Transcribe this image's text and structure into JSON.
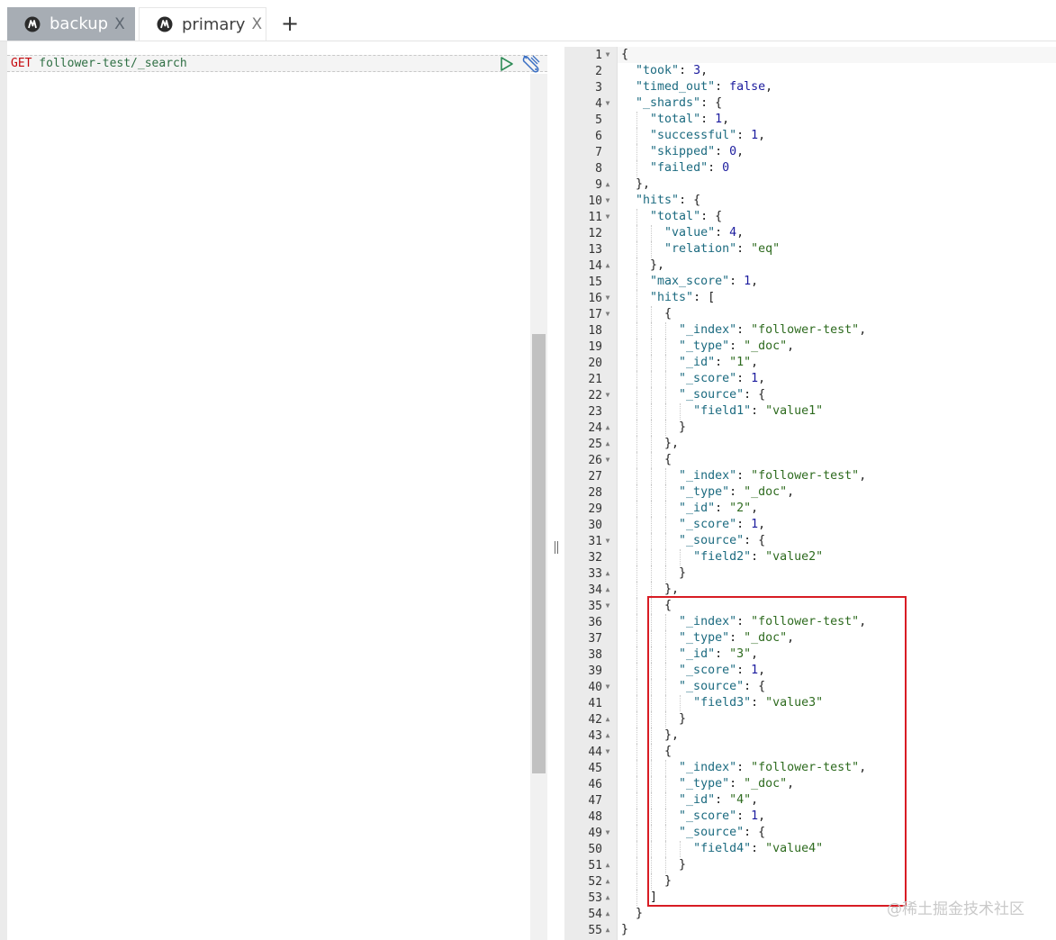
{
  "tabs": [
    {
      "label": "backup",
      "close": "X",
      "active": true,
      "icon": "elastic-logo-icon"
    },
    {
      "label": "primary",
      "close": "X",
      "active": false,
      "icon": "elastic-logo-icon"
    }
  ],
  "add_tab": "+",
  "request": {
    "method": "GET",
    "path": " follower-test/_search"
  },
  "response": {
    "lines": [
      {
        "n": "1",
        "fold": "down",
        "indent": 0,
        "tokens": [
          [
            "p",
            "{"
          ]
        ]
      },
      {
        "n": "2",
        "fold": "",
        "indent": 1,
        "tokens": [
          [
            "k",
            "\"took\""
          ],
          [
            "p",
            ": "
          ],
          [
            "n",
            "3"
          ],
          [
            "p",
            ","
          ]
        ]
      },
      {
        "n": "3",
        "fold": "",
        "indent": 1,
        "tokens": [
          [
            "k",
            "\"timed_out\""
          ],
          [
            "p",
            ": "
          ],
          [
            "b",
            "false"
          ],
          [
            "p",
            ","
          ]
        ]
      },
      {
        "n": "4",
        "fold": "down",
        "indent": 1,
        "tokens": [
          [
            "k",
            "\"_shards\""
          ],
          [
            "p",
            ": {"
          ]
        ]
      },
      {
        "n": "5",
        "fold": "",
        "indent": 2,
        "tokens": [
          [
            "k",
            "\"total\""
          ],
          [
            "p",
            ": "
          ],
          [
            "n",
            "1"
          ],
          [
            "p",
            ","
          ]
        ]
      },
      {
        "n": "6",
        "fold": "",
        "indent": 2,
        "tokens": [
          [
            "k",
            "\"successful\""
          ],
          [
            "p",
            ": "
          ],
          [
            "n",
            "1"
          ],
          [
            "p",
            ","
          ]
        ]
      },
      {
        "n": "7",
        "fold": "",
        "indent": 2,
        "tokens": [
          [
            "k",
            "\"skipped\""
          ],
          [
            "p",
            ": "
          ],
          [
            "n",
            "0"
          ],
          [
            "p",
            ","
          ]
        ]
      },
      {
        "n": "8",
        "fold": "",
        "indent": 2,
        "tokens": [
          [
            "k",
            "\"failed\""
          ],
          [
            "p",
            ": "
          ],
          [
            "n",
            "0"
          ]
        ]
      },
      {
        "n": "9",
        "fold": "up",
        "indent": 1,
        "tokens": [
          [
            "p",
            "},"
          ]
        ]
      },
      {
        "n": "10",
        "fold": "down",
        "indent": 1,
        "tokens": [
          [
            "k",
            "\"hits\""
          ],
          [
            "p",
            ": {"
          ]
        ]
      },
      {
        "n": "11",
        "fold": "down",
        "indent": 2,
        "tokens": [
          [
            "k",
            "\"total\""
          ],
          [
            "p",
            ": {"
          ]
        ]
      },
      {
        "n": "12",
        "fold": "",
        "indent": 3,
        "tokens": [
          [
            "k",
            "\"value\""
          ],
          [
            "p",
            ": "
          ],
          [
            "n",
            "4"
          ],
          [
            "p",
            ","
          ]
        ]
      },
      {
        "n": "13",
        "fold": "",
        "indent": 3,
        "tokens": [
          [
            "k",
            "\"relation\""
          ],
          [
            "p",
            ": "
          ],
          [
            "s",
            "\"eq\""
          ]
        ]
      },
      {
        "n": "14",
        "fold": "up",
        "indent": 2,
        "tokens": [
          [
            "p",
            "},"
          ]
        ]
      },
      {
        "n": "15",
        "fold": "",
        "indent": 2,
        "tokens": [
          [
            "k",
            "\"max_score\""
          ],
          [
            "p",
            ": "
          ],
          [
            "n",
            "1"
          ],
          [
            "p",
            ","
          ]
        ]
      },
      {
        "n": "16",
        "fold": "down",
        "indent": 2,
        "tokens": [
          [
            "k",
            "\"hits\""
          ],
          [
            "p",
            ": ["
          ]
        ]
      },
      {
        "n": "17",
        "fold": "down",
        "indent": 3,
        "tokens": [
          [
            "p",
            "{"
          ]
        ]
      },
      {
        "n": "18",
        "fold": "",
        "indent": 4,
        "tokens": [
          [
            "k",
            "\"_index\""
          ],
          [
            "p",
            ": "
          ],
          [
            "s",
            "\"follower-test\""
          ],
          [
            "p",
            ","
          ]
        ]
      },
      {
        "n": "19",
        "fold": "",
        "indent": 4,
        "tokens": [
          [
            "k",
            "\"_type\""
          ],
          [
            "p",
            ": "
          ],
          [
            "s",
            "\"_doc\""
          ],
          [
            "p",
            ","
          ]
        ]
      },
      {
        "n": "20",
        "fold": "",
        "indent": 4,
        "tokens": [
          [
            "k",
            "\"_id\""
          ],
          [
            "p",
            ": "
          ],
          [
            "s",
            "\"1\""
          ],
          [
            "p",
            ","
          ]
        ]
      },
      {
        "n": "21",
        "fold": "",
        "indent": 4,
        "tokens": [
          [
            "k",
            "\"_score\""
          ],
          [
            "p",
            ": "
          ],
          [
            "n",
            "1"
          ],
          [
            "p",
            ","
          ]
        ]
      },
      {
        "n": "22",
        "fold": "down",
        "indent": 4,
        "tokens": [
          [
            "k",
            "\"_source\""
          ],
          [
            "p",
            ": {"
          ]
        ]
      },
      {
        "n": "23",
        "fold": "",
        "indent": 5,
        "tokens": [
          [
            "k",
            "\"field1\""
          ],
          [
            "p",
            ": "
          ],
          [
            "s",
            "\"value1\""
          ]
        ]
      },
      {
        "n": "24",
        "fold": "up",
        "indent": 4,
        "tokens": [
          [
            "p",
            "}"
          ]
        ]
      },
      {
        "n": "25",
        "fold": "up",
        "indent": 3,
        "tokens": [
          [
            "p",
            "},"
          ]
        ]
      },
      {
        "n": "26",
        "fold": "down",
        "indent": 3,
        "tokens": [
          [
            "p",
            "{"
          ]
        ]
      },
      {
        "n": "27",
        "fold": "",
        "indent": 4,
        "tokens": [
          [
            "k",
            "\"_index\""
          ],
          [
            "p",
            ": "
          ],
          [
            "s",
            "\"follower-test\""
          ],
          [
            "p",
            ","
          ]
        ]
      },
      {
        "n": "28",
        "fold": "",
        "indent": 4,
        "tokens": [
          [
            "k",
            "\"_type\""
          ],
          [
            "p",
            ": "
          ],
          [
            "s",
            "\"_doc\""
          ],
          [
            "p",
            ","
          ]
        ]
      },
      {
        "n": "29",
        "fold": "",
        "indent": 4,
        "tokens": [
          [
            "k",
            "\"_id\""
          ],
          [
            "p",
            ": "
          ],
          [
            "s",
            "\"2\""
          ],
          [
            "p",
            ","
          ]
        ]
      },
      {
        "n": "30",
        "fold": "",
        "indent": 4,
        "tokens": [
          [
            "k",
            "\"_score\""
          ],
          [
            "p",
            ": "
          ],
          [
            "n",
            "1"
          ],
          [
            "p",
            ","
          ]
        ]
      },
      {
        "n": "31",
        "fold": "down",
        "indent": 4,
        "tokens": [
          [
            "k",
            "\"_source\""
          ],
          [
            "p",
            ": {"
          ]
        ]
      },
      {
        "n": "32",
        "fold": "",
        "indent": 5,
        "tokens": [
          [
            "k",
            "\"field2\""
          ],
          [
            "p",
            ": "
          ],
          [
            "s",
            "\"value2\""
          ]
        ]
      },
      {
        "n": "33",
        "fold": "up",
        "indent": 4,
        "tokens": [
          [
            "p",
            "}"
          ]
        ]
      },
      {
        "n": "34",
        "fold": "up",
        "indent": 3,
        "tokens": [
          [
            "p",
            "},"
          ]
        ]
      },
      {
        "n": "35",
        "fold": "down",
        "indent": 3,
        "tokens": [
          [
            "p",
            "{"
          ]
        ]
      },
      {
        "n": "36",
        "fold": "",
        "indent": 4,
        "tokens": [
          [
            "k",
            "\"_index\""
          ],
          [
            "p",
            ": "
          ],
          [
            "s",
            "\"follower-test\""
          ],
          [
            "p",
            ","
          ]
        ]
      },
      {
        "n": "37",
        "fold": "",
        "indent": 4,
        "tokens": [
          [
            "k",
            "\"_type\""
          ],
          [
            "p",
            ": "
          ],
          [
            "s",
            "\"_doc\""
          ],
          [
            "p",
            ","
          ]
        ]
      },
      {
        "n": "38",
        "fold": "",
        "indent": 4,
        "tokens": [
          [
            "k",
            "\"_id\""
          ],
          [
            "p",
            ": "
          ],
          [
            "s",
            "\"3\""
          ],
          [
            "p",
            ","
          ]
        ]
      },
      {
        "n": "39",
        "fold": "",
        "indent": 4,
        "tokens": [
          [
            "k",
            "\"_score\""
          ],
          [
            "p",
            ": "
          ],
          [
            "n",
            "1"
          ],
          [
            "p",
            ","
          ]
        ]
      },
      {
        "n": "40",
        "fold": "down",
        "indent": 4,
        "tokens": [
          [
            "k",
            "\"_source\""
          ],
          [
            "p",
            ": {"
          ]
        ]
      },
      {
        "n": "41",
        "fold": "",
        "indent": 5,
        "tokens": [
          [
            "k",
            "\"field3\""
          ],
          [
            "p",
            ": "
          ],
          [
            "s",
            "\"value3\""
          ]
        ]
      },
      {
        "n": "42",
        "fold": "up",
        "indent": 4,
        "tokens": [
          [
            "p",
            "}"
          ]
        ]
      },
      {
        "n": "43",
        "fold": "up",
        "indent": 3,
        "tokens": [
          [
            "p",
            "},"
          ]
        ]
      },
      {
        "n": "44",
        "fold": "down",
        "indent": 3,
        "tokens": [
          [
            "p",
            "{"
          ]
        ]
      },
      {
        "n": "45",
        "fold": "",
        "indent": 4,
        "tokens": [
          [
            "k",
            "\"_index\""
          ],
          [
            "p",
            ": "
          ],
          [
            "s",
            "\"follower-test\""
          ],
          [
            "p",
            ","
          ]
        ]
      },
      {
        "n": "46",
        "fold": "",
        "indent": 4,
        "tokens": [
          [
            "k",
            "\"_type\""
          ],
          [
            "p",
            ": "
          ],
          [
            "s",
            "\"_doc\""
          ],
          [
            "p",
            ","
          ]
        ]
      },
      {
        "n": "47",
        "fold": "",
        "indent": 4,
        "tokens": [
          [
            "k",
            "\"_id\""
          ],
          [
            "p",
            ": "
          ],
          [
            "s",
            "\"4\""
          ],
          [
            "p",
            ","
          ]
        ]
      },
      {
        "n": "48",
        "fold": "",
        "indent": 4,
        "tokens": [
          [
            "k",
            "\"_score\""
          ],
          [
            "p",
            ": "
          ],
          [
            "n",
            "1"
          ],
          [
            "p",
            ","
          ]
        ]
      },
      {
        "n": "49",
        "fold": "down",
        "indent": 4,
        "tokens": [
          [
            "k",
            "\"_source\""
          ],
          [
            "p",
            ": {"
          ]
        ]
      },
      {
        "n": "50",
        "fold": "",
        "indent": 5,
        "tokens": [
          [
            "k",
            "\"field4\""
          ],
          [
            "p",
            ": "
          ],
          [
            "s",
            "\"value4\""
          ]
        ]
      },
      {
        "n": "51",
        "fold": "up",
        "indent": 4,
        "tokens": [
          [
            "p",
            "}"
          ]
        ]
      },
      {
        "n": "52",
        "fold": "up",
        "indent": 3,
        "tokens": [
          [
            "p",
            "}"
          ]
        ]
      },
      {
        "n": "53",
        "fold": "up",
        "indent": 2,
        "tokens": [
          [
            "p",
            "]"
          ]
        ]
      },
      {
        "n": "54",
        "fold": "up",
        "indent": 1,
        "tokens": [
          [
            "p",
            "}"
          ]
        ]
      },
      {
        "n": "55",
        "fold": "up",
        "indent": 0,
        "tokens": [
          [
            "p",
            "}"
          ]
        ]
      }
    ]
  },
  "watermark": "@稀土掘金技术社区",
  "colors": {
    "method": "#c5060b",
    "path": "#2f6f44",
    "key": "#1c6b80",
    "string": "#2e6b1f",
    "number": "#1c1c9e",
    "highlight": "#d81c24",
    "active_tab": "#a7adb4"
  }
}
